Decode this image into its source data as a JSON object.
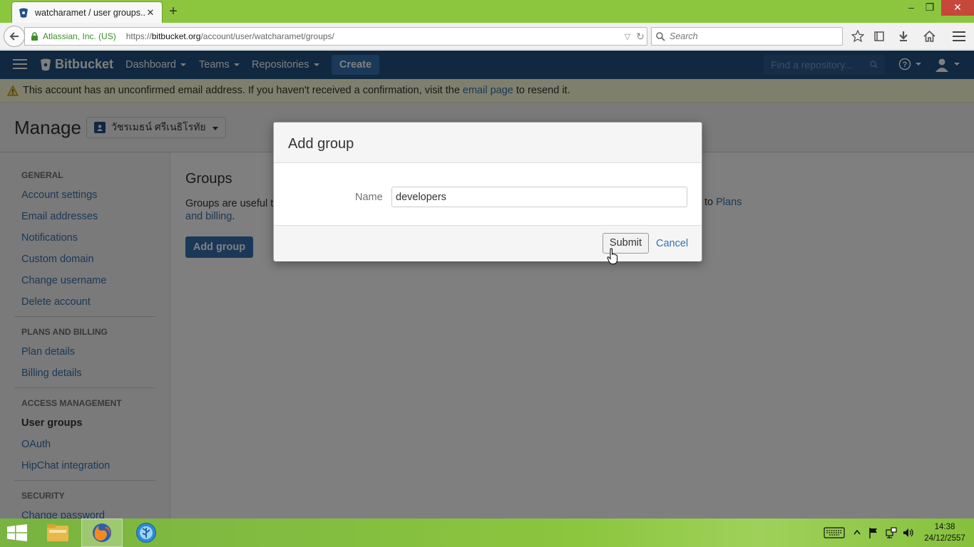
{
  "browser": {
    "tab_title": "watcharamet / user groups...",
    "tab_close": "✕",
    "new_tab": "+",
    "site_identity": "Atlassian, Inc. (US)",
    "url_prefix": "https://",
    "url_domain": "bitbucket.org",
    "url_path": "/account/user/watcharamet/groups/",
    "search_placeholder": "Search",
    "window_controls": {
      "minimize": "–",
      "restore": "❐",
      "close": "✕"
    }
  },
  "header": {
    "logo": "Bitbucket",
    "nav": {
      "dashboard": "Dashboard",
      "teams": "Teams",
      "repositories": "Repositories"
    },
    "create": "Create",
    "find_placeholder": "Find a repository..."
  },
  "warning": {
    "text_before": "This account has an unconfirmed email address. If you haven't received a confirmation, visit the",
    "link": "email page",
    "text_after": "to resend it."
  },
  "manage": {
    "title": "Manage",
    "account_name": "วัชรเมธน์ ศรีเนธิโรทัย"
  },
  "sidebar": {
    "general_heading": "GENERAL",
    "account_settings": "Account settings",
    "email_addresses": "Email addresses",
    "notifications": "Notifications",
    "custom_domain": "Custom domain",
    "change_username": "Change username",
    "delete_account": "Delete account",
    "plans_heading": "PLANS AND BILLING",
    "plan_details": "Plan details",
    "billing_details": "Billing details",
    "access_heading": "ACCESS MANAGEMENT",
    "user_groups": "User groups",
    "oauth": "OAuth",
    "hipchat": "HipChat integration",
    "security_heading": "SECURITY",
    "change_password": "Change password"
  },
  "content": {
    "title": "Groups",
    "desc_start": "Groups are useful t",
    "desc_end_prefix": "to",
    "link_part1": "Plans",
    "link_part2": "and billing",
    "desc_period": ".",
    "add_group": "Add group"
  },
  "dialog": {
    "title": "Add group",
    "name_label": "Name",
    "name_value": "developers",
    "submit": "Submit",
    "cancel": "Cancel"
  },
  "taskbar": {
    "time": "14:38",
    "date": "24/12/2557"
  },
  "colors": {
    "bitbucket_blue": "#205081",
    "link_blue": "#3572b0",
    "firefox_green_theme": "#8cc63f"
  }
}
